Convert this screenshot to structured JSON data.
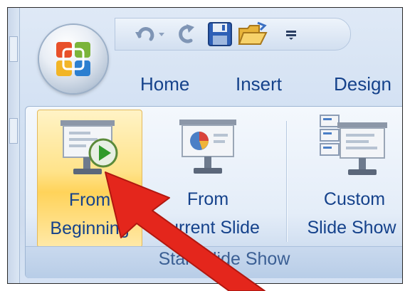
{
  "quick_access": {
    "icons": [
      "undo-icon",
      "redo-icon",
      "save-icon",
      "open-folder-icon",
      "customize-toolbar-icon"
    ]
  },
  "tabs": [
    {
      "label": "Home"
    },
    {
      "label": "Insert"
    },
    {
      "label": "Design"
    }
  ],
  "ribbon": {
    "group_label": "Start Slide Show",
    "buttons": [
      {
        "line1": "From",
        "line2": "Beginning",
        "icon": "projector-play-icon",
        "state": "highlighted"
      },
      {
        "line1": "From",
        "line2": "Current Slide",
        "icon": "projector-pie-chart-icon"
      },
      {
        "line1": "Custom",
        "line2": "Slide Show",
        "icon": "projector-slides-icon",
        "has_dropdown": true
      }
    ]
  },
  "colors": {
    "tab_text": "#15428b",
    "highlight": "#ffd35a",
    "annotation_arrow": "#e4261c"
  }
}
